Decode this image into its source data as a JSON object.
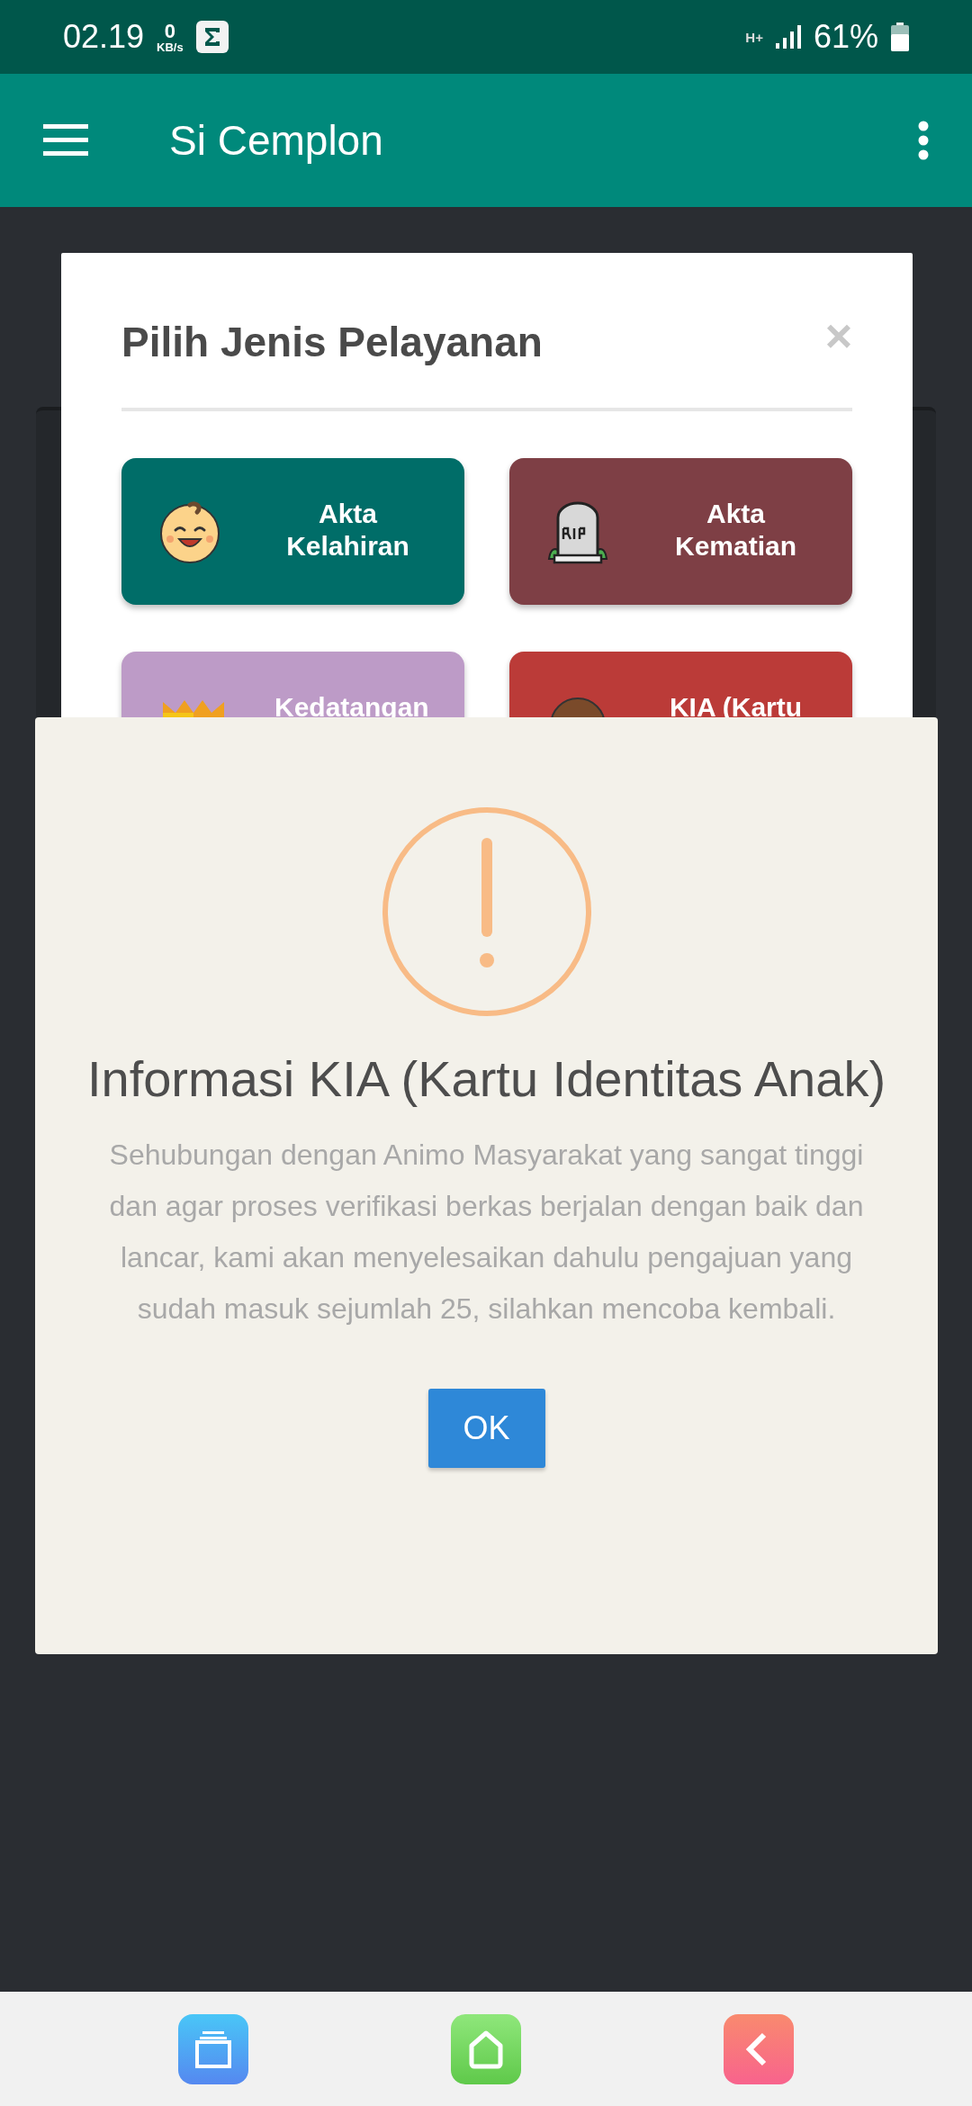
{
  "status_bar": {
    "time": "02.19",
    "net_speed": {
      "value": "0",
      "unit": "KB/s"
    },
    "network": "H+",
    "battery": "61%"
  },
  "app_bar": {
    "title": "Si Cemplon"
  },
  "service_dialog": {
    "title": "Pilih Jenis Pelayanan",
    "close": "×",
    "tiles": [
      {
        "label": "Akta Kelahiran",
        "color": "#006d68",
        "kind": "baby"
      },
      {
        "label": "Akta Kematian",
        "color": "#7e3f45",
        "kind": "grave"
      },
      {
        "label": "Kedatangan",
        "color": "#bd9bc7",
        "kind": "box"
      },
      {
        "label": "KIA (Kartu",
        "color": "#bb3b38",
        "kind": "person"
      }
    ]
  },
  "alert": {
    "title": "Informasi KIA (Kartu Identitas Anak)",
    "message": "Sehubungan dengan Animo Masyarakat yang sangat tinggi dan agar proses verifikasi berkas berjalan dengan baik dan lancar, kami akan menyelesaikan dahulu pengajuan yang sudah masuk sejumlah 25, silahkan mencoba kembali.",
    "button": "OK"
  }
}
